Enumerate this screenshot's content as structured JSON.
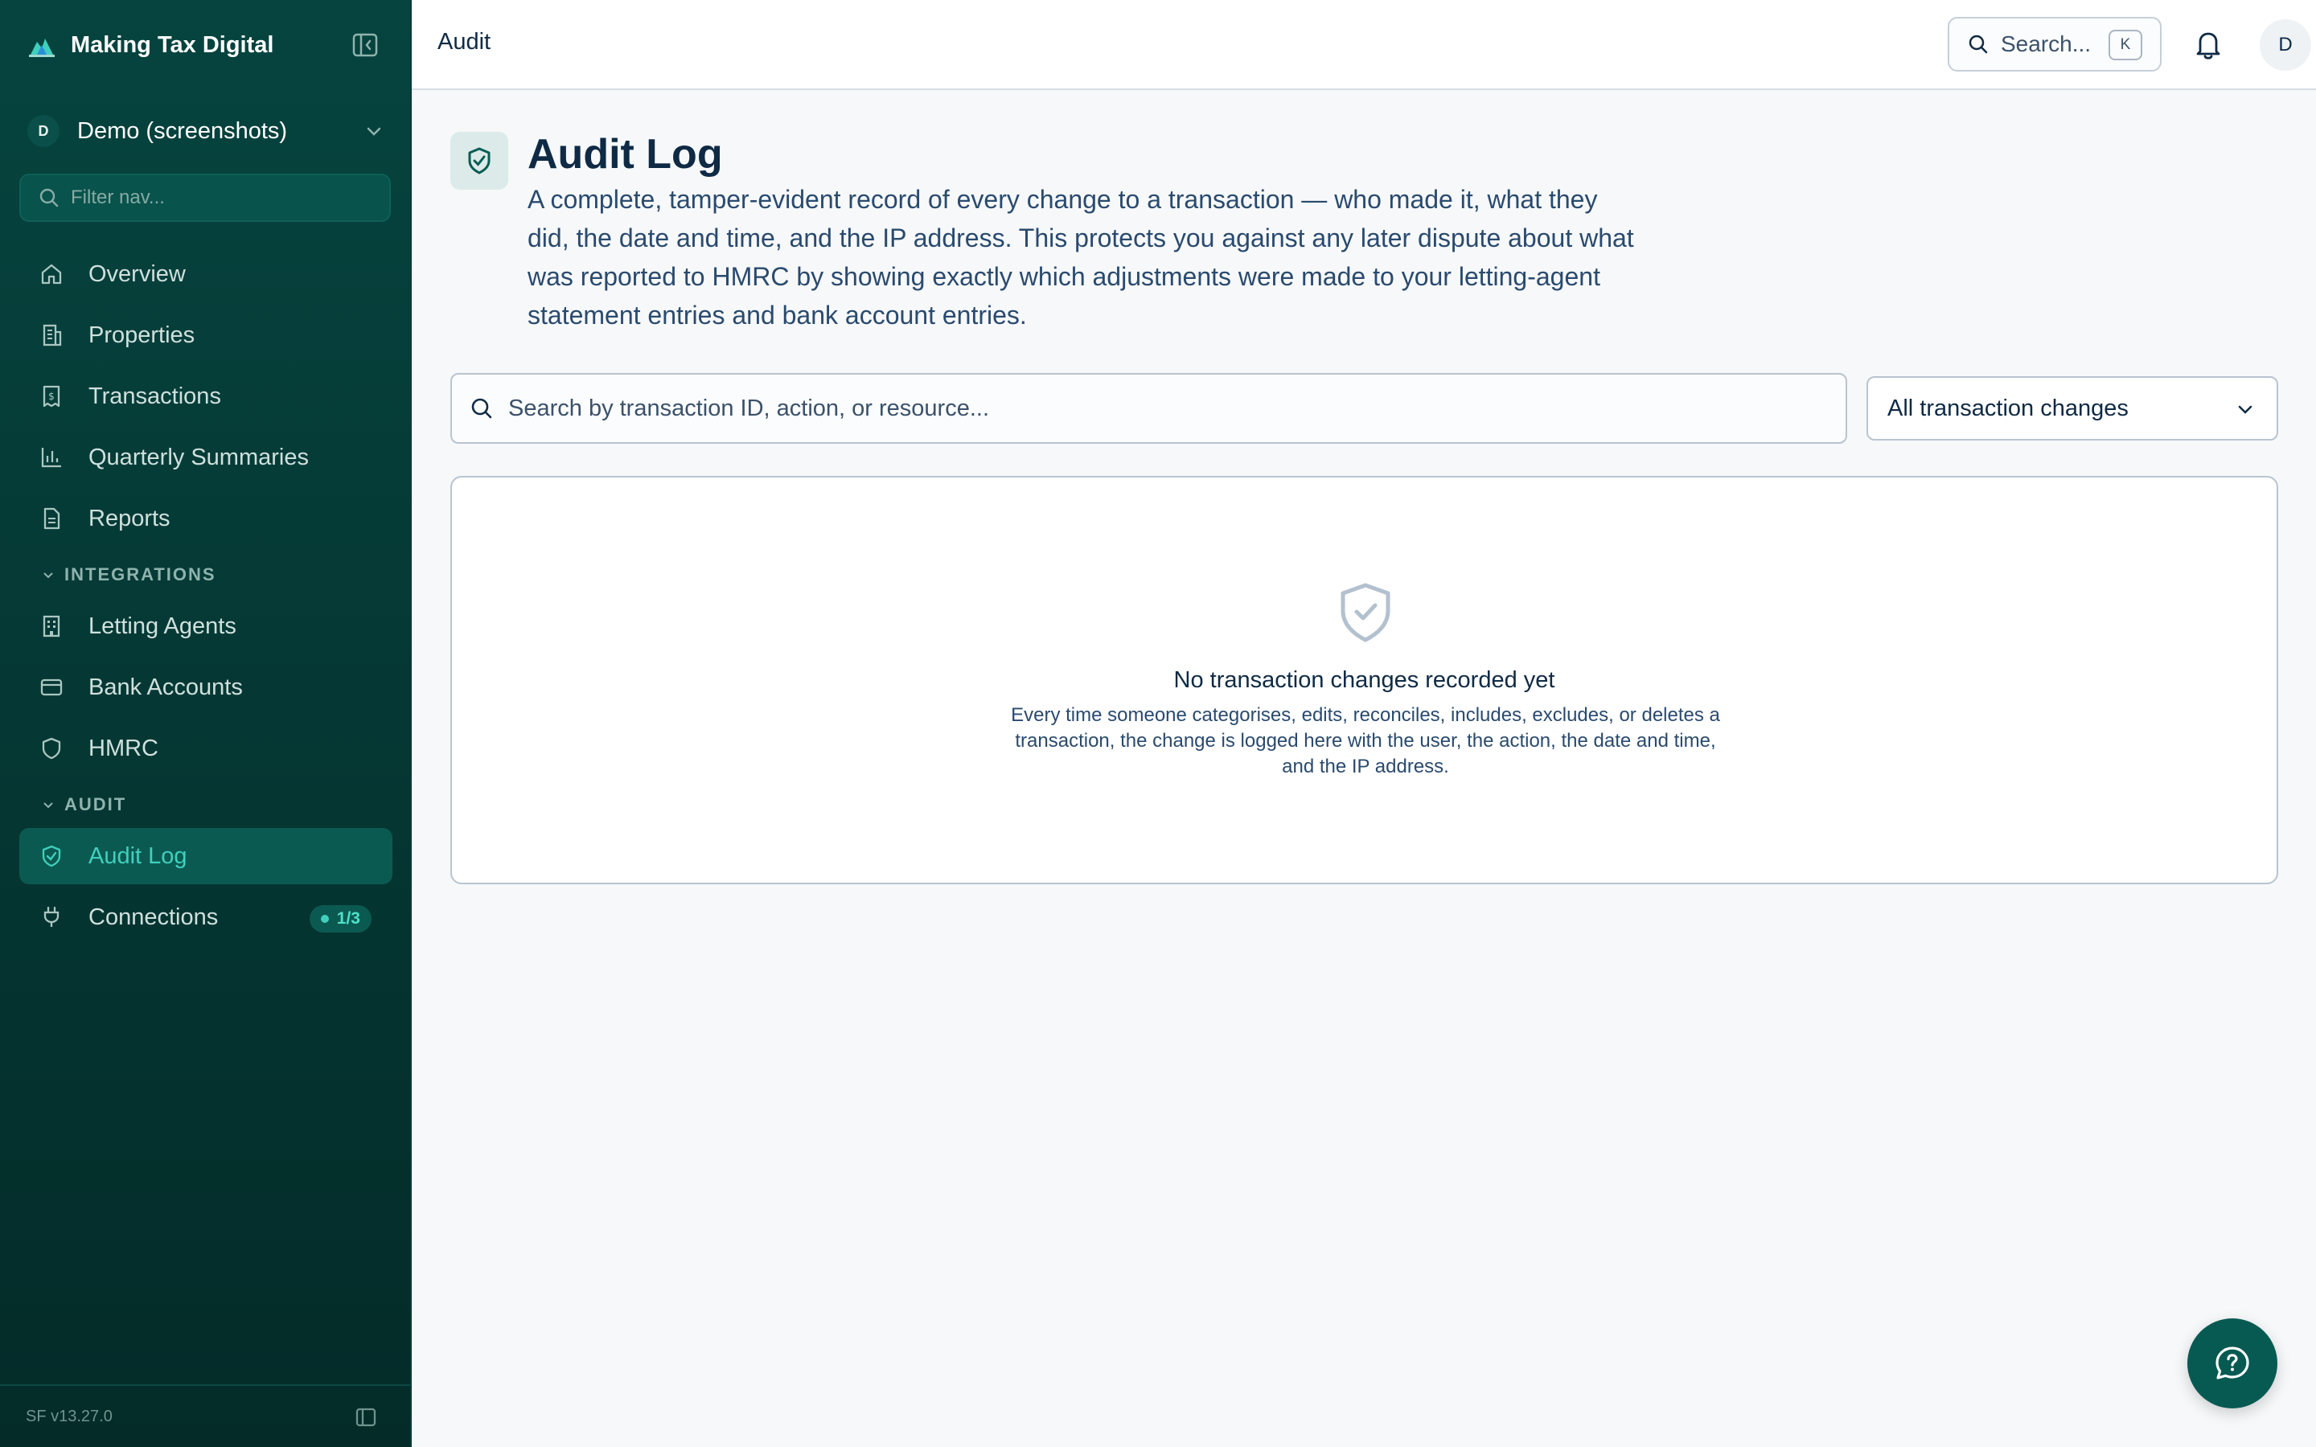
{
  "app": {
    "title": "Making Tax Digital",
    "version": "SF v13.27.0"
  },
  "org": {
    "avatar_letter": "D",
    "name": "Demo (screenshots)"
  },
  "sidebar": {
    "filter_placeholder": "Filter nav...",
    "items": [
      {
        "label": "Overview",
        "icon": "home-icon"
      },
      {
        "label": "Properties",
        "icon": "building-icon"
      },
      {
        "label": "Transactions",
        "icon": "receipt-icon"
      },
      {
        "label": "Quarterly Summaries",
        "icon": "bar-chart-icon"
      },
      {
        "label": "Reports",
        "icon": "document-icon"
      }
    ],
    "integrations_label": "INTEGRATIONS",
    "integrations": [
      {
        "label": "Letting Agents",
        "icon": "office-building-icon"
      },
      {
        "label": "Bank Accounts",
        "icon": "credit-card-icon"
      },
      {
        "label": "HMRC",
        "icon": "shield-icon"
      }
    ],
    "audit_label": "AUDIT",
    "audit": [
      {
        "label": "Audit Log",
        "icon": "shield-check-icon",
        "active": true
      },
      {
        "label": "Connections",
        "icon": "plug-icon",
        "badge": "1/3"
      }
    ]
  },
  "topbar": {
    "breadcrumb": "Audit",
    "search_label": "Search...",
    "search_shortcut": "K",
    "user_initial": "D"
  },
  "page": {
    "title": "Audit Log",
    "description": "A complete, tamper-evident record of every change to a transaction — who made it, what they did, the date and time, and the IP address. This protects you against any later dispute about what was reported to HMRC by showing exactly which adjustments were made to your letting-agent statement entries and bank account entries.",
    "search_placeholder": "Search by transaction ID, action, or resource...",
    "filter_selected": "All transaction changes",
    "empty_title": "No transaction changes recorded yet",
    "empty_description": "Every time someone categorises, edits, reconciles, includes, excludes, or deletes a transaction, the change is logged here with the user, the action, the date and time, and the IP address."
  },
  "colors": {
    "sidebar_bg": "#053a36",
    "accent": "#3fd0bd",
    "fab_bg": "#075a52"
  }
}
